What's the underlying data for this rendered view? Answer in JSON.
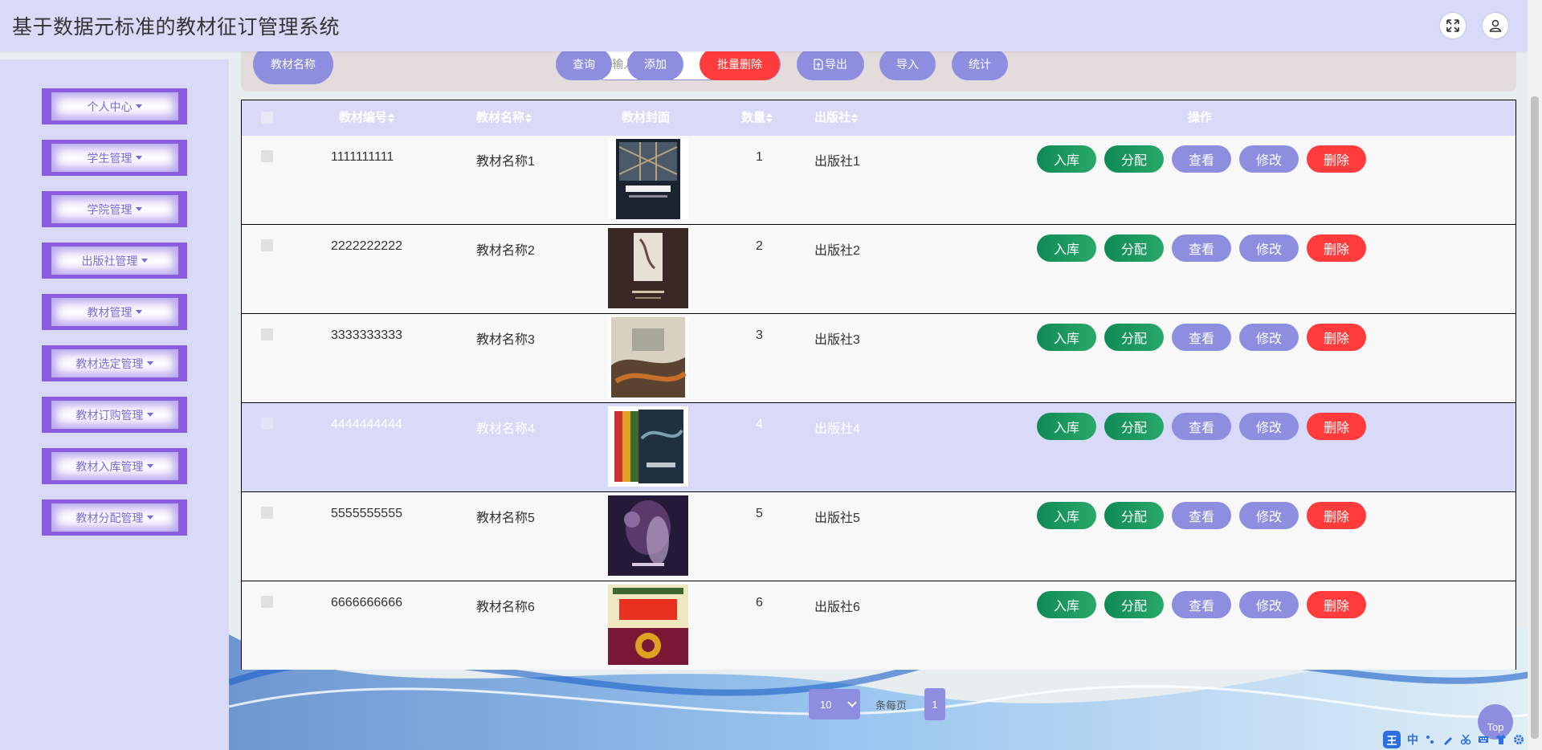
{
  "header": {
    "title": "基于数据元标准的教材征订管理系统",
    "icons": [
      "fullscreen-icon",
      "user-icon"
    ]
  },
  "sidebar": {
    "items": [
      {
        "label": "个人中心"
      },
      {
        "label": "学生管理"
      },
      {
        "label": "学院管理"
      },
      {
        "label": "出版社管理"
      },
      {
        "label": "教材管理"
      },
      {
        "label": "教材选定管理"
      },
      {
        "label": "教材订购管理"
      },
      {
        "label": "教材入库管理"
      },
      {
        "label": "教材分配管理"
      }
    ]
  },
  "toolbar": {
    "field_label": "教材名称",
    "search_placeholder": "请输入教材名称",
    "query": "查询",
    "add": "添加",
    "batch_delete": "批量删除",
    "export": "导出",
    "import": "导入",
    "stats": "统计"
  },
  "table": {
    "columns": {
      "code": "教材编号",
      "name": "教材名称",
      "cover": "教材封面",
      "qty": "数量",
      "publisher": "出版社",
      "ops": "操作"
    },
    "actions": {
      "stock_in": "入库",
      "assign": "分配",
      "view": "查看",
      "edit": "修改",
      "delete": "删除"
    },
    "rows": [
      {
        "code": "1111111111",
        "name": "教材名称1",
        "qty": "1",
        "publisher": "出版社1"
      },
      {
        "code": "2222222222",
        "name": "教材名称2",
        "qty": "2",
        "publisher": "出版社2"
      },
      {
        "code": "3333333333",
        "name": "教材名称3",
        "qty": "3",
        "publisher": "出版社3"
      },
      {
        "code": "4444444444",
        "name": "教材名称4",
        "qty": "4",
        "publisher": "出版社4"
      },
      {
        "code": "5555555555",
        "name": "教材名称5",
        "qty": "5",
        "publisher": "出版社5"
      },
      {
        "code": "6666666666",
        "name": "教材名称6",
        "qty": "6",
        "publisher": "出版社6"
      }
    ],
    "highlighted_row": 4
  },
  "pagination": {
    "page_size": "10",
    "per_page_label": "条每页",
    "current_page": "1"
  },
  "back_to_top": "Top",
  "ime": {
    "main": "王",
    "mode": "中"
  },
  "colors": {
    "header_bg": "#d8daf8",
    "accent": "#8d8ee0",
    "danger": "#ff3b3b",
    "success": "#0f8a55",
    "sidebar_border": "#8b5ce0"
  }
}
